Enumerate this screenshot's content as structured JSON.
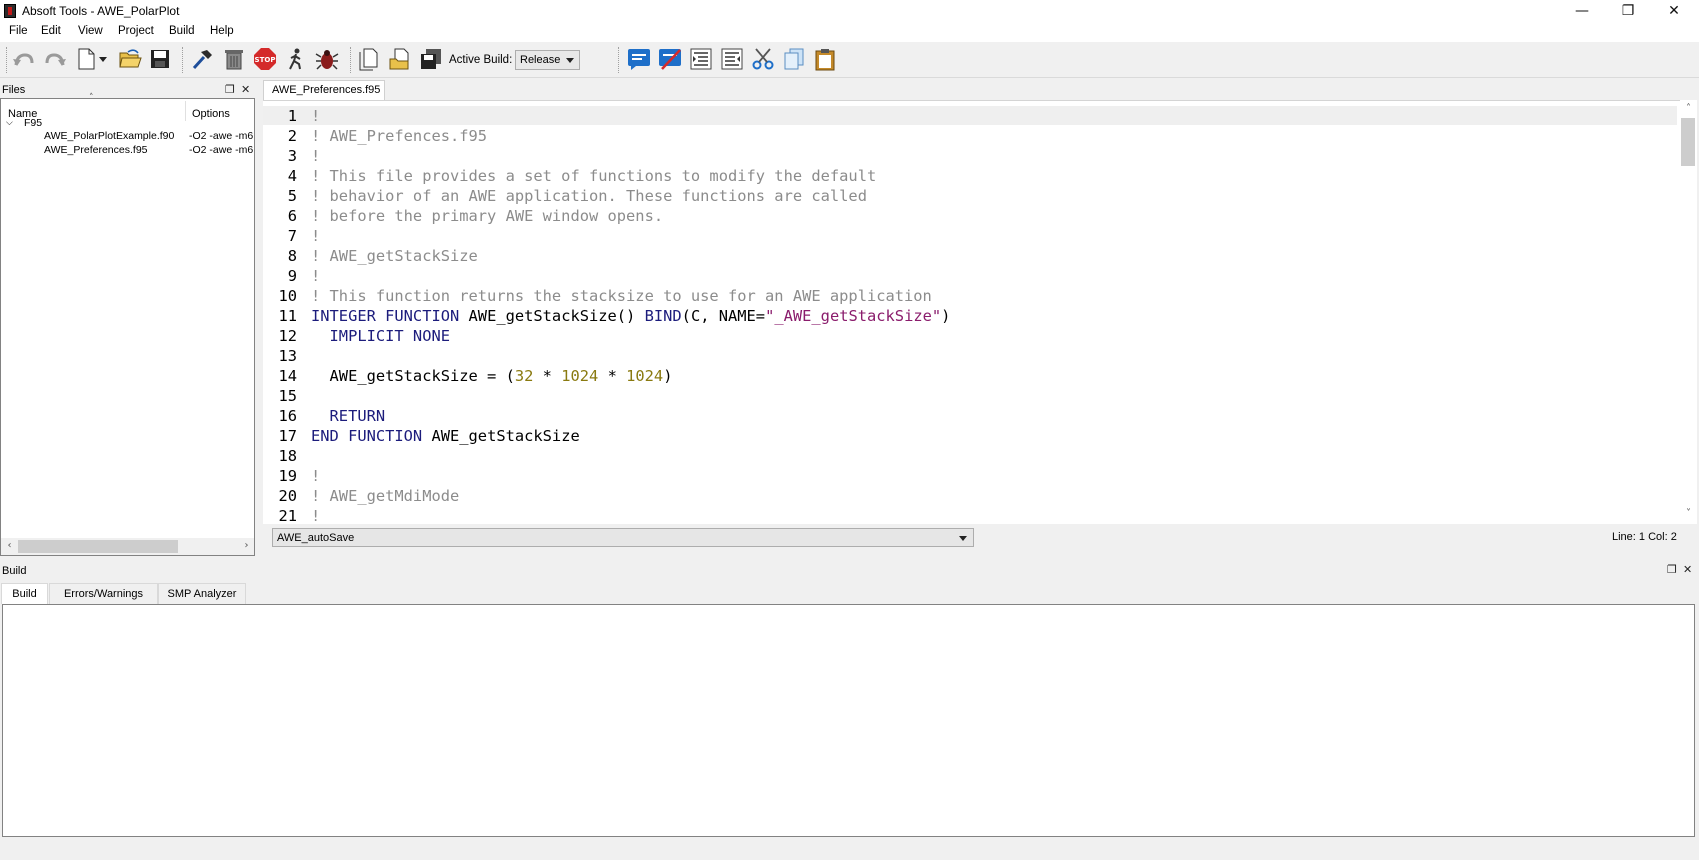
{
  "window": {
    "title": "Absoft Tools - AWE_PolarPlot",
    "minimize_glyph": "—",
    "maximize_glyph": "❐",
    "close_glyph": "✕"
  },
  "menu": [
    "File",
    "Edit",
    "View",
    "Project",
    "Build",
    "Help"
  ],
  "toolbar": {
    "active_build_label": "Active Build:",
    "active_build_value": "Release",
    "icons": [
      "undo-icon",
      "redo-icon",
      "new-file-icon",
      "open-folder-icon",
      "save-icon",
      "build-hammer-icon",
      "trash-icon",
      "stop-icon",
      "run-icon",
      "debug-bug-icon",
      "new-project-icon",
      "open-project-icon",
      "save-all-icon",
      "comment-icon",
      "uncomment-icon",
      "indent-icon",
      "outdent-icon",
      "cut-icon",
      "copy-icon",
      "paste-icon"
    ],
    "stop_text": "STOP"
  },
  "files_panel": {
    "title": "Files",
    "columns": [
      "Name",
      "Options"
    ],
    "root_folder": "F95",
    "files": [
      {
        "name": "AWE_PolarPlotExample.f90",
        "options": "-O2 -awe -m6"
      },
      {
        "name": "AWE_Preferences.f95",
        "options": "-O2 -awe -m6"
      }
    ]
  },
  "editor": {
    "tab": "AWE_Preferences.f95",
    "function_selector": "AWE_autoSave",
    "cursor_position": "Line: 1 Col: 2",
    "lines": [
      {
        "n": "1",
        "segs": [
          {
            "t": "!",
            "c": "cm"
          }
        ]
      },
      {
        "n": "2",
        "segs": [
          {
            "t": "! AWE_Prefences.f95",
            "c": "cm"
          }
        ]
      },
      {
        "n": "3",
        "segs": [
          {
            "t": "!",
            "c": "cm"
          }
        ]
      },
      {
        "n": "4",
        "segs": [
          {
            "t": "! This file provides a set of functions to modify the default",
            "c": "cm"
          }
        ]
      },
      {
        "n": "5",
        "segs": [
          {
            "t": "! behavior of an AWE application. These functions are called",
            "c": "cm"
          }
        ]
      },
      {
        "n": "6",
        "segs": [
          {
            "t": "! before the primary AWE window opens.",
            "c": "cm"
          }
        ]
      },
      {
        "n": "7",
        "segs": [
          {
            "t": "!",
            "c": "cm"
          }
        ]
      },
      {
        "n": "8",
        "segs": [
          {
            "t": "! AWE_getStackSize",
            "c": "cm"
          }
        ]
      },
      {
        "n": "9",
        "segs": [
          {
            "t": "!",
            "c": "cm"
          }
        ]
      },
      {
        "n": "10",
        "segs": [
          {
            "t": "! This function returns the stacksize to use for an AWE application",
            "c": "cm"
          }
        ]
      },
      {
        "n": "11",
        "segs": [
          {
            "t": "INTEGER FUNCTION",
            "c": "kw"
          },
          {
            "t": " AWE_getStackSize() ",
            "c": ""
          },
          {
            "t": "BIND",
            "c": "kw"
          },
          {
            "t": "(C, NAME=",
            "c": ""
          },
          {
            "t": "\"_AWE_getStackSize\"",
            "c": "st"
          },
          {
            "t": ")",
            "c": ""
          }
        ]
      },
      {
        "n": "12",
        "segs": [
          {
            "t": "  IMPLICIT NONE",
            "c": "kw"
          }
        ]
      },
      {
        "n": "13",
        "segs": []
      },
      {
        "n": "14",
        "segs": [
          {
            "t": "  AWE_getStackSize = (",
            "c": ""
          },
          {
            "t": "32",
            "c": "nm"
          },
          {
            "t": " * ",
            "c": ""
          },
          {
            "t": "1024",
            "c": "nm"
          },
          {
            "t": " * ",
            "c": ""
          },
          {
            "t": "1024",
            "c": "nm"
          },
          {
            "t": ")",
            "c": ""
          }
        ]
      },
      {
        "n": "15",
        "segs": []
      },
      {
        "n": "16",
        "segs": [
          {
            "t": "  RETURN",
            "c": "kw"
          }
        ]
      },
      {
        "n": "17",
        "segs": [
          {
            "t": "END FUNCTION",
            "c": "kw"
          },
          {
            "t": " AWE_getStackSize",
            "c": ""
          }
        ]
      },
      {
        "n": "18",
        "segs": []
      },
      {
        "n": "19",
        "segs": [
          {
            "t": "!",
            "c": "cm"
          }
        ]
      },
      {
        "n": "20",
        "segs": [
          {
            "t": "! AWE_getMdiMode",
            "c": "cm"
          }
        ]
      },
      {
        "n": "21",
        "segs": [
          {
            "t": "!",
            "c": "cm"
          }
        ]
      }
    ]
  },
  "build_panel": {
    "title": "Build",
    "tabs": [
      "Build",
      "Errors/Warnings",
      "SMP Analyzer"
    ],
    "active_tab": "Build"
  }
}
